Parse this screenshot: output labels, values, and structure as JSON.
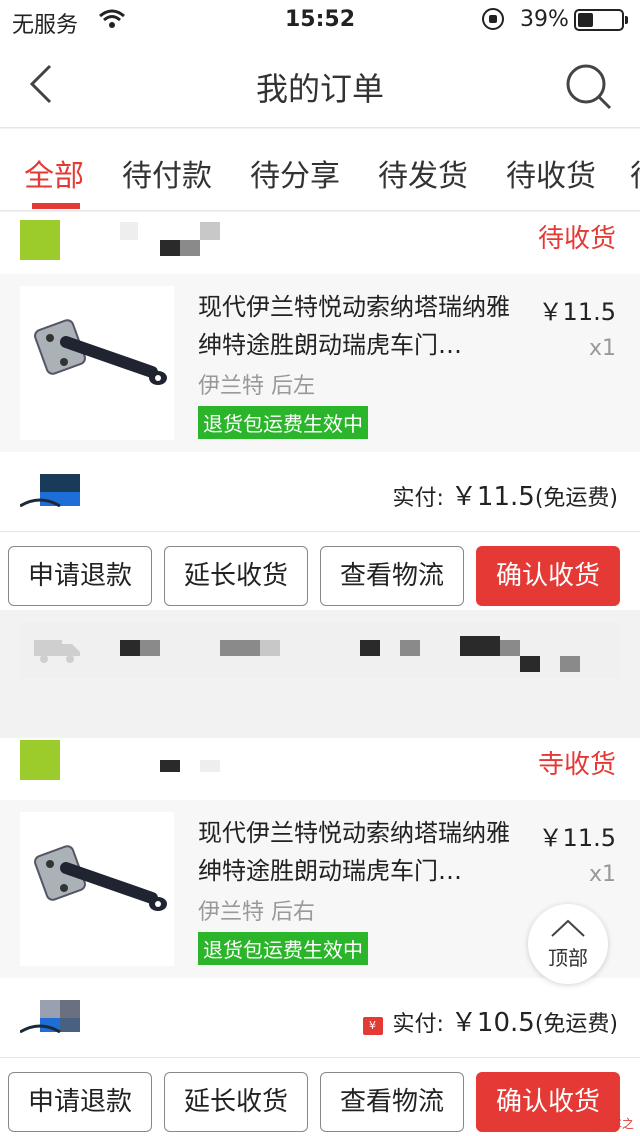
{
  "status_bar": {
    "carrier": "无服务",
    "time": "15:52",
    "battery": "39%"
  },
  "nav": {
    "title": "我的订单"
  },
  "tabs": [
    {
      "label": "全部",
      "active": true
    },
    {
      "label": "待付款",
      "active": false
    },
    {
      "label": "待分享",
      "active": false
    },
    {
      "label": "待发货",
      "active": false
    },
    {
      "label": "待收货",
      "active": false
    },
    {
      "label": "待",
      "active": false
    }
  ],
  "orders": [
    {
      "status": "待收货",
      "product": {
        "name": "现代伊兰特悦动索纳塔瑞纳雅绅特途胜朗动瑞虎车门…",
        "spec": "伊兰特 后左",
        "tag": "退货包运费生效中",
        "price": "￥11.5",
        "qty": "x1"
      },
      "payment": {
        "label": "实付:",
        "amount": "￥11.5",
        "shipping": "(免运费)"
      },
      "actions": [
        "申请退款",
        "延长收货",
        "查看物流",
        "确认收货"
      ]
    },
    {
      "status": "寺收货",
      "product": {
        "name": "现代伊兰特悦动索纳塔瑞纳雅绅特途胜朗动瑞虎车门…",
        "spec": "伊兰特 后右",
        "tag": "退货包运费生效中",
        "price": "￥11.5",
        "qty": "x1"
      },
      "payment": {
        "label": "实付:",
        "amount": "￥10.5",
        "shipping": "(免运费)"
      },
      "actions": [
        "申请退款",
        "延长收货",
        "查看物流",
        "确认收货"
      ]
    }
  ],
  "back_to_top": "顶部",
  "watermark": "汽车之",
  "colors": {
    "accent": "#e53935",
    "tag_green": "#2ab52a",
    "shop_logo": "#9ccc2b"
  },
  "icons": [
    "back-chevron-icon",
    "search-icon",
    "wifi-icon",
    "lock-rotation-icon",
    "battery-icon",
    "truck-icon",
    "chevron-up-icon",
    "coupon-icon"
  ]
}
